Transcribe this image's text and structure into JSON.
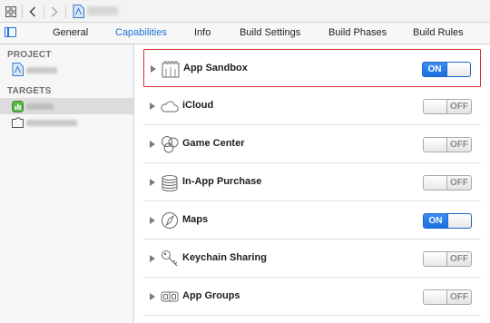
{
  "tabs": [
    {
      "label": "General",
      "active": false
    },
    {
      "label": "Capabilities",
      "active": true
    },
    {
      "label": "Info",
      "active": false
    },
    {
      "label": "Build Settings",
      "active": false
    },
    {
      "label": "Build Phases",
      "active": false
    },
    {
      "label": "Build Rules",
      "active": false
    }
  ],
  "sidebar": {
    "project_header": "PROJECT",
    "targets_header": "TARGETS"
  },
  "capabilities": [
    {
      "label": "App Sandbox",
      "state": "ON",
      "icon": "sandbox-icon",
      "highlighted": true
    },
    {
      "label": "iCloud",
      "state": "OFF",
      "icon": "cloud-icon"
    },
    {
      "label": "Game Center",
      "state": "OFF",
      "icon": "game-center-icon"
    },
    {
      "label": "In-App Purchase",
      "state": "OFF",
      "icon": "coins-icon"
    },
    {
      "label": "Maps",
      "state": "ON",
      "icon": "compass-icon"
    },
    {
      "label": "Keychain Sharing",
      "state": "OFF",
      "icon": "key-icon"
    },
    {
      "label": "App Groups",
      "state": "OFF",
      "icon": "app-groups-icon"
    }
  ],
  "colors": {
    "accent": "#1a73d9",
    "highlight_border": "#d72d2d",
    "toggle_on": "#2a7fe8"
  }
}
